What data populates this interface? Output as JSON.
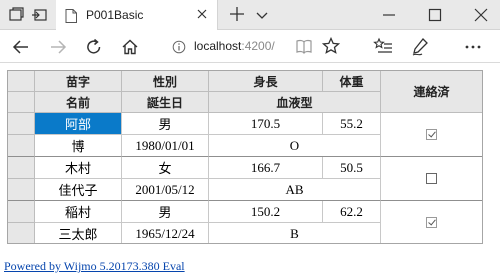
{
  "browser": {
    "tab_title": "P001Basic",
    "address_host": "localhost",
    "address_port": ":4200/"
  },
  "grid": {
    "header_row1": {
      "col1": "苗字",
      "col2": "性別",
      "col3": "身長",
      "col4": "体重",
      "col5": "連絡済"
    },
    "header_row2": {
      "col1": "名前",
      "col2": "誕生日",
      "col34": "血液型"
    },
    "records": [
      {
        "last_name": "阿部",
        "gender": "男",
        "height": "170.5",
        "weight": "55.2",
        "first_name": "博",
        "birthday": "1980/01/01",
        "blood_type": "O",
        "contacted": true
      },
      {
        "last_name": "木村",
        "gender": "女",
        "height": "166.7",
        "weight": "50.5",
        "first_name": "佳代子",
        "birthday": "2001/05/12",
        "blood_type": "AB",
        "contacted": false
      },
      {
        "last_name": "稲村",
        "gender": "男",
        "height": "150.2",
        "weight": "62.2",
        "first_name": "三太郎",
        "birthday": "1965/12/24",
        "blood_type": "B",
        "contacted": true
      }
    ],
    "selected_cell_color": "#0a7ac9"
  },
  "footer": {
    "link_text": "Powered by Wijmo 5.20173.380 Eval"
  }
}
